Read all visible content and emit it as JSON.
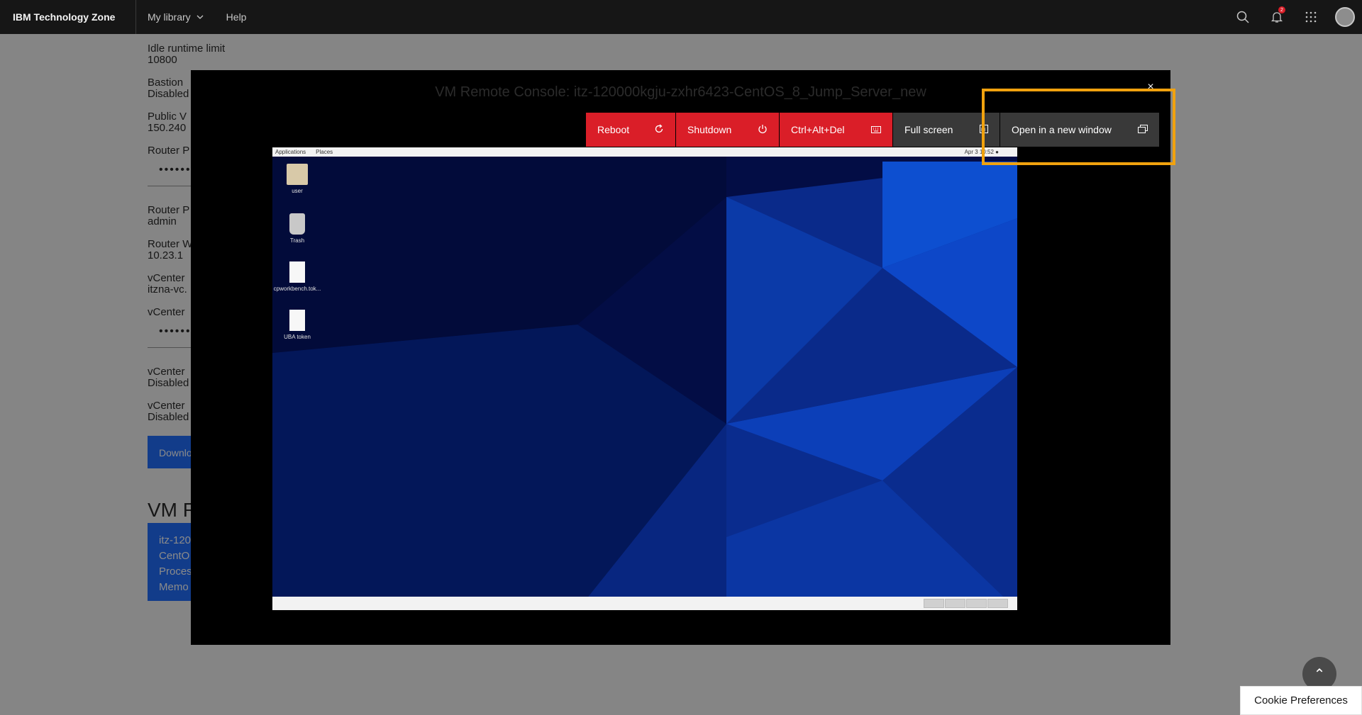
{
  "header": {
    "brand": "IBM Technology Zone",
    "nav": {
      "my_library": "My library",
      "help": "Help"
    },
    "notification_count": "2",
    "icons": [
      "search-icon",
      "bell-icon",
      "app-switcher-icon",
      "avatar"
    ]
  },
  "background": {
    "fields": [
      {
        "label": "Idle runtime limit",
        "value": "10800"
      },
      {
        "label": "Bastion",
        "value": "Disabled"
      },
      {
        "label": "Public V",
        "value": "150.240"
      },
      {
        "label": "Router P",
        "value": ""
      },
      {
        "label": "Router P",
        "value": "admin"
      },
      {
        "label": "Router W",
        "value": "10.23.1"
      },
      {
        "label": "vCenter",
        "value": "itzna-vc."
      },
      {
        "label": "vCenter",
        "value": ""
      },
      {
        "label": "vCenter",
        "value": "Disabled"
      },
      {
        "label": "vCenter",
        "value": "Disabled"
      }
    ],
    "password_mask": "••••••••",
    "download_button": "Downlo",
    "section_title": "VM R",
    "vm_card": [
      "itz-120",
      "CentO",
      "Proces",
      "Memo"
    ]
  },
  "modal": {
    "title": "VM Remote Console: itz-120000kgju-zxhr6423-CentOS_8_Jump_Server_new",
    "close": "×",
    "buttons": {
      "reboot": "Reboot",
      "shutdown": "Shutdown",
      "ctrl_alt_del": "Ctrl+Alt+Del",
      "full_screen": "Full screen",
      "open_new_window": "Open in a new window"
    }
  },
  "vm": {
    "topbar": {
      "applications": "Applications",
      "places": "Places",
      "clock": "Apr 3  10:52 ●"
    },
    "desktop_icons": [
      {
        "label": "user",
        "icon": "folder-icon"
      },
      {
        "label": "Trash",
        "icon": "trash-icon"
      },
      {
        "label": "cpworkbench.tok...",
        "icon": "document-icon"
      },
      {
        "label": "UBA token",
        "icon": "document-icon"
      }
    ]
  },
  "footer": {
    "cookie": "Cookie Preferences",
    "scroll_top": "⌃"
  },
  "colors": {
    "accent_red": "#da1e28",
    "highlight": "#f1a20e",
    "ibm_blue": "#0f62fe"
  }
}
